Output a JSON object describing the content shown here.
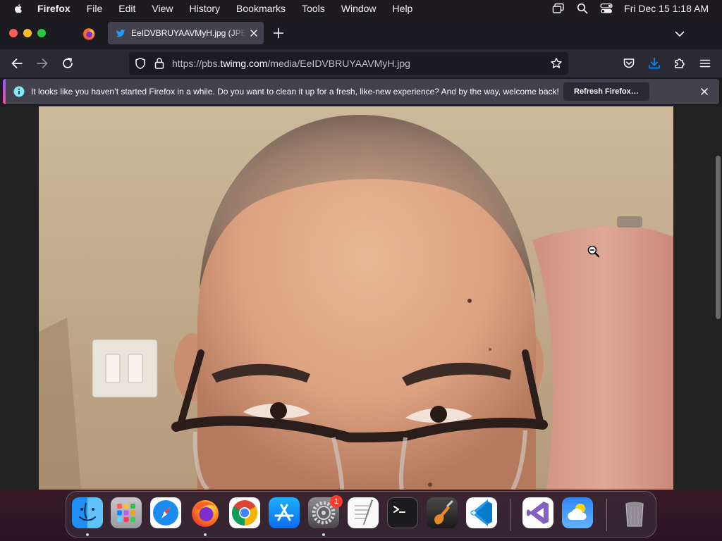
{
  "menubar": {
    "app_name": "Firefox",
    "items": [
      "File",
      "Edit",
      "View",
      "History",
      "Bookmarks",
      "Tools",
      "Window",
      "Help"
    ],
    "clock": "Fri Dec 15  1:18 AM"
  },
  "tabs": {
    "active_title": "EeIDVBRUYAAVMyH.jpg (JPEG Image"
  },
  "urlbar": {
    "scheme": "https://pbs.",
    "host": "twimg.com",
    "path": "/media/EeIDVBRUYAAVMyH.jpg"
  },
  "notification": {
    "message": "It looks like you haven’t started Firefox in a while. Do you want to clean it up for a fresh, like-new experience? And by the way, welcome back!",
    "button_label": "Refresh Firefox…"
  },
  "dock": {
    "apps": [
      "Finder",
      "Launchpad",
      "Safari",
      "Firefox",
      "Google Chrome",
      "App Store",
      "System Settings",
      "TextEdit",
      "Terminal",
      "GarageBand",
      "Visual Studio Code",
      "Visual Studio",
      "Weather",
      "Trash"
    ],
    "system_settings_badge": "1"
  },
  "colors": {
    "accent_blue": "#0a84ff",
    "notification_accent": "#9059ff"
  }
}
